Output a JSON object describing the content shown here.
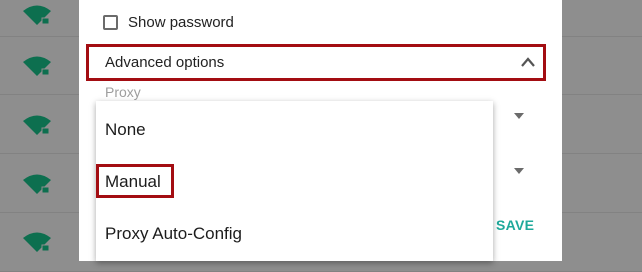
{
  "background": {
    "network_rows": [
      {
        "icon": "wifi-locked-icon"
      },
      {
        "icon": "wifi-locked-icon"
      },
      {
        "icon": "wifi-locked-icon"
      },
      {
        "icon": "wifi-locked-icon"
      },
      {
        "icon": "wifi-locked-icon"
      }
    ]
  },
  "dialog": {
    "show_password_label": "Show password",
    "show_password_checked": false,
    "advanced_options_label": "Advanced options",
    "proxy_label": "Proxy",
    "save_label": "SAVE"
  },
  "proxy_menu": {
    "options": [
      "None",
      "Manual",
      "Proxy Auto-Config"
    ],
    "highlighted": "Manual"
  },
  "colors": {
    "highlight_border": "#a30d12",
    "accent": "#1ea99b",
    "wifi_icon": "#0d6f4f"
  }
}
